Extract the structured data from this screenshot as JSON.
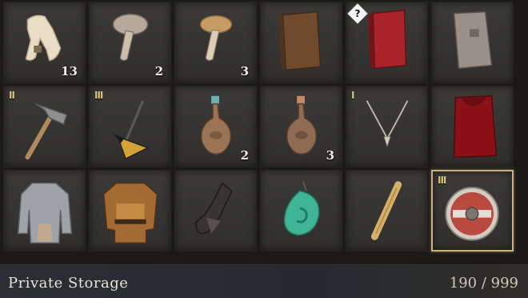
{
  "inventory": {
    "slots": [
      {
        "item": "scarf-icon",
        "count": "13"
      },
      {
        "item": "mushroom-icon",
        "count": "2"
      },
      {
        "item": "tan-mushroom-icon",
        "count": "3"
      },
      {
        "item": "brown-book-icon"
      },
      {
        "item": "red-book-icon",
        "badge": "?"
      },
      {
        "item": "grey-book-icon"
      },
      {
        "item": "hammer-icon",
        "tier": "II"
      },
      {
        "item": "sickle-icon",
        "tier": "III"
      },
      {
        "item": "potion-flask-icon",
        "count": "2"
      },
      {
        "item": "potion-flask-icon",
        "count": "3"
      },
      {
        "item": "necklace-icon",
        "tier": "I"
      },
      {
        "item": "red-cloak-icon"
      },
      {
        "item": "gambeson-icon"
      },
      {
        "item": "leather-armor-icon"
      },
      {
        "item": "gauntlet-icon"
      },
      {
        "item": "jade-pendant-icon"
      },
      {
        "item": "scroll-icon"
      },
      {
        "item": "round-shield-icon",
        "tier": "III",
        "selected": true
      }
    ]
  },
  "footer": {
    "title": "Private Storage",
    "capacity": "190 / 999"
  },
  "colors": {
    "slot_bg": "#353432",
    "selected_border": "#c9b27e",
    "tier_text": "#d8c27a",
    "footer_bg": "#2a2f35"
  }
}
